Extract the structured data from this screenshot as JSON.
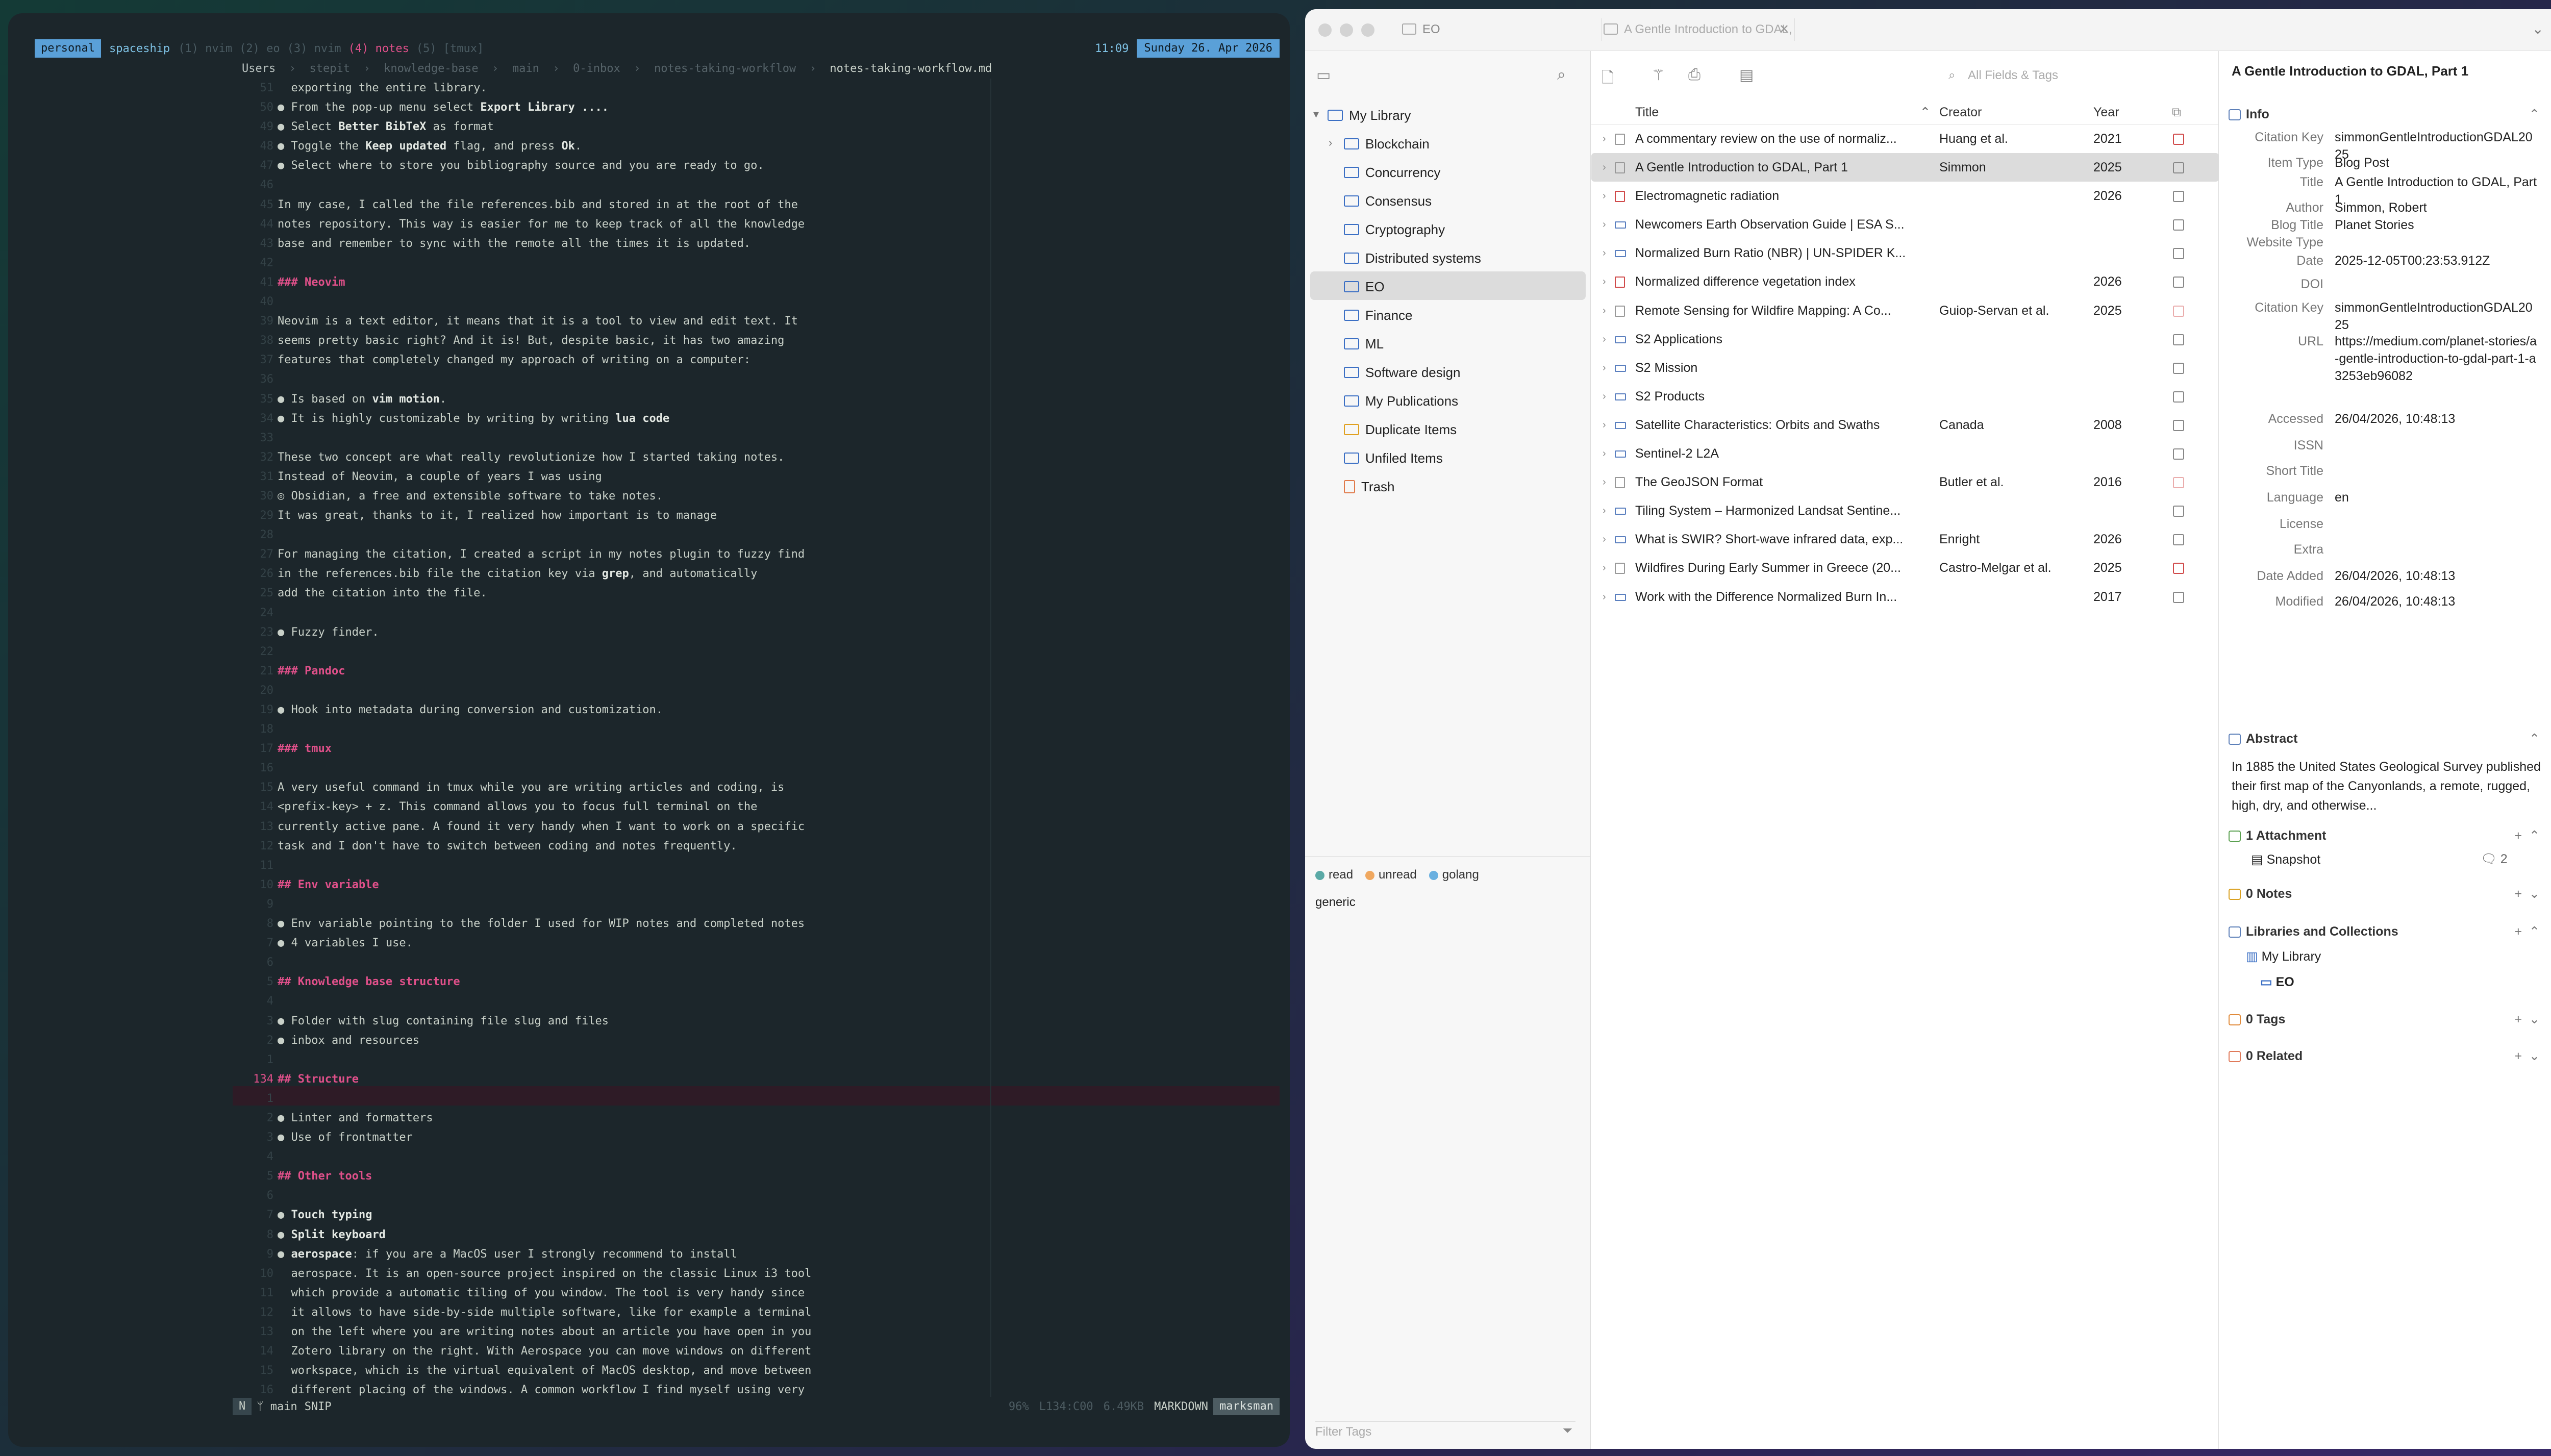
{
  "terminal": {
    "tmux": {
      "session": "personal",
      "host": "spaceship",
      "windows": [
        {
          "label": "(1) nvim",
          "current": false
        },
        {
          "label": "(2) eo",
          "current": false
        },
        {
          "label": "(3) nvim",
          "current": false
        },
        {
          "label": "(4) notes",
          "current": true
        },
        {
          "label": "(5) [tmux]",
          "current": false
        }
      ],
      "time": "11:09",
      "date": "Sunday 26. Apr 2026"
    },
    "breadcrumb": [
      "Users",
      "stepit",
      "knowledge-base",
      "main",
      "0-inbox",
      "notes-taking-workflow",
      "notes-taking-workflow.md"
    ],
    "gutter": [
      "52",
      "",
      "",
      "",
      "",
      "",
      "6",
      "",
      "",
      "",
      "",
      "",
      "",
      "",
      "",
      "",
      "",
      "",
      "",
      "",
      "",
      "",
      "",
      "",
      "",
      "",
      "",
      "",
      "",
      "",
      "",
      "",
      "",
      "",
      "",
      "",
      "",
      "",
      "",
      "",
      "",
      "",
      "",
      "",
      "",
      "",
      "",
      "",
      "",
      "",
      "",
      "",
      "",
      "",
      "",
      "",
      "",
      "",
      "",
      "",
      "",
      "",
      "",
      "",
      "",
      "",
      "",
      "",
      "",
      "",
      "",
      "",
      "",
      "",
      "",
      "",
      "",
      "",
      "",
      "",
      "",
      ""
    ],
    "lines": [
      "  exporting the entire library.",
      "● From the pop-up menu select **Export Library ....**",
      "● Select **Better BibTeX** as format",
      "● Toggle the **Keep updated** flag, and press **Ok**.",
      "● Select where to store you bibliography source and you are ready to go.",
      "",
      "In my case, I called the file references.bib and stored in at the root of the",
      "notes repository. This way is easier for me to keep track of all the knowledge",
      "base and remember to sync with the remote all the times it is updated.",
      "",
      "### Neovim",
      "",
      "Neovim is a text editor, it means that it is a tool to view and edit text. It",
      "seems pretty basic right? And it is! But, despite basic, it has two amazing",
      "features that completely changed my approach of writing on a computer:",
      "",
      "● Is based on **vim motion**.",
      "● It is highly customizable by writing by writing **lua code**",
      "",
      "These two concept are what really revolutionize how I started taking notes.",
      "Instead of Neovim, a couple of years I was using",
      "◎ Obsidian, a free and extensible software to take notes.",
      "It was great, thanks to it, I realized how important is to manage",
      "",
      "For managing the citation, I created a script in my notes plugin to fuzzy find",
      "in the references.bib file the citation key via **grep**, and automatically",
      "add the citation into the file.",
      "",
      "● Fuzzy finder.",
      "",
      "### Pandoc",
      "",
      "● Hook into metadata during conversion and customization.",
      "",
      "### tmux",
      "",
      "A very useful command in tmux while you are writing articles and coding, is",
      "<prefix-key> + z. This command allows you to focus full terminal on the",
      "currently active pane. A found it very handy when I want to work on a specific",
      "task and I don't have to switch between coding and notes frequently.",
      "",
      "## Env variable",
      "",
      "● Env variable pointing to the folder I used for WIP notes and completed notes",
      "● 4 variables I use.",
      "",
      "## Knowledge base structure",
      "",
      "● Folder with slug containing file slug and files",
      "● inbox and resources",
      "",
      "## Structure",
      "",
      "● Linter and formatters",
      "● Use of frontmatter",
      "",
      "## Other tools",
      "",
      "● **Touch typing**",
      "● **Split keyboard**",
      "● **aerospace**: if you are a MacOS user I strongly recommend to install",
      "  aerospace. It is an open-source project inspired on the classic Linux i3 tool",
      "  which provide a automatic tiling of you window. The tool is very handy since",
      "  it allows to have side-by-side multiple software, like for example a terminal",
      "  on the left where you are writing notes about an article you have open in you",
      "  Zotero library on the right. With Aerospace you can move windows on different",
      "  workspace, which is the virtual equivalent of MacOS desktop, and move between",
      "  different placing of the windows. A common workflow I find myself using very"
    ],
    "cursor_line_number": "134",
    "status": {
      "mode": "N",
      "branch": "ᛘ main",
      "snip": "SNIP",
      "percent": "96%",
      "position": "L134:C00",
      "size": "6.49KB",
      "filetype": "MARKDOWN",
      "lsp": "marksman"
    }
  },
  "zotero": {
    "tab_collection": "EO",
    "tab_item": "A Gentle Introduction to GDAL, Part 1",
    "collections": [
      {
        "label": "My Library",
        "level": 0,
        "twisty": "▾",
        "kind": "library"
      },
      {
        "label": "Blockchain",
        "level": 1,
        "twisty": "›",
        "kind": "folder"
      },
      {
        "label": "Concurrency",
        "level": 1,
        "twisty": "",
        "kind": "folder"
      },
      {
        "label": "Consensus",
        "level": 1,
        "twisty": "",
        "kind": "folder"
      },
      {
        "label": "Cryptography",
        "level": 1,
        "twisty": "",
        "kind": "folder"
      },
      {
        "label": "Distributed systems",
        "level": 1,
        "twisty": "",
        "kind": "folder"
      },
      {
        "label": "EO",
        "level": 1,
        "twisty": "",
        "kind": "folder",
        "selected": true
      },
      {
        "label": "Finance",
        "level": 1,
        "twisty": "",
        "kind": "folder"
      },
      {
        "label": "ML",
        "level": 1,
        "twisty": "",
        "kind": "folder"
      },
      {
        "label": "Software design",
        "level": 1,
        "twisty": "",
        "kind": "folder"
      },
      {
        "label": "My Publications",
        "level": 1,
        "twisty": "",
        "kind": "folder"
      },
      {
        "label": "Duplicate Items",
        "level": 1,
        "twisty": "",
        "kind": "warn"
      },
      {
        "label": "Unfiled Items",
        "level": 1,
        "twisty": "",
        "kind": "folder"
      },
      {
        "label": "Trash",
        "level": 1,
        "twisty": "",
        "kind": "trash"
      }
    ],
    "tags": [
      {
        "label": "read",
        "color": "#5aa9a6"
      },
      {
        "label": "unread",
        "color": "#f0a860"
      },
      {
        "label": "golang",
        "color": "#6ab0e0"
      }
    ],
    "generic_tag": "generic",
    "filter_tags_placeholder": "Filter Tags",
    "search_placeholder": "All Fields & Tags",
    "columns": {
      "title": "Title",
      "sort": "⌃",
      "creator": "Creator",
      "year": "Year",
      "attach": "⧉"
    },
    "items": [
      {
        "title": "A commentary review on the use of normaliz...",
        "creator": "Huang et al.",
        "year": "2021",
        "type": "doc",
        "attach": "pdf"
      },
      {
        "title": "A Gentle Introduction to GDAL, Part 1",
        "creator": "Simmon",
        "year": "2025",
        "type": "doc",
        "attach": "snap",
        "selected": true
      },
      {
        "title": "Electromagnetic radiation",
        "creator": "",
        "year": "2026",
        "type": "book",
        "attach": "snap"
      },
      {
        "title": "Newcomers Earth Observation Guide | ESA S...",
        "creator": "",
        "year": "",
        "type": "blog",
        "attach": "snap"
      },
      {
        "title": "Normalized Burn Ratio (NBR) | UN-SPIDER K...",
        "creator": "",
        "year": "",
        "type": "blog",
        "attach": "snap"
      },
      {
        "title": "Normalized difference vegetation index",
        "creator": "",
        "year": "2026",
        "type": "book",
        "attach": "snap"
      },
      {
        "title": "Remote Sensing for Wildfire Mapping: A Co...",
        "creator": "Guiop-Servan et al.",
        "year": "2025",
        "type": "doc",
        "attach": "pdf-light"
      },
      {
        "title": "S2 Applications",
        "creator": "",
        "year": "",
        "type": "blog",
        "attach": "snap"
      },
      {
        "title": "S2 Mission",
        "creator": "",
        "year": "",
        "type": "blog",
        "attach": "snap"
      },
      {
        "title": "S2 Products",
        "creator": "",
        "year": "",
        "type": "blog",
        "attach": "snap"
      },
      {
        "title": "Satellite Characteristics: Orbits and Swaths",
        "creator": "Canada",
        "year": "2008",
        "type": "blog",
        "attach": "snap"
      },
      {
        "title": "Sentinel-2 L2A",
        "creator": "",
        "year": "",
        "type": "blog",
        "attach": "snap"
      },
      {
        "title": "The GeoJSON Format",
        "creator": "Butler et al.",
        "year": "2016",
        "type": "doc",
        "attach": "pdf-light"
      },
      {
        "title": "Tiling System – Harmonized Landsat Sentine...",
        "creator": "",
        "year": "",
        "type": "blog",
        "attach": "snap"
      },
      {
        "title": "What is SWIR? Short-wave infrared data, exp...",
        "creator": "Enright",
        "year": "2026",
        "type": "blog",
        "attach": "snap"
      },
      {
        "title": "Wildfires During Early Summer in Greece (20...",
        "creator": "Castro-Melgar et al.",
        "year": "2025",
        "type": "doc",
        "attach": "pdf"
      },
      {
        "title": "Work with the Difference Normalized Burn In...",
        "creator": "",
        "year": "2017",
        "type": "blog",
        "attach": "snap"
      }
    ],
    "info": {
      "header_title": "A Gentle Introduction to GDAL, Part 1",
      "section": "Info",
      "fields": [
        {
          "label": "Citation Key",
          "value": "simmonGentleIntroductionGDAL2025"
        },
        {
          "label": "Item Type",
          "value": "Blog Post"
        },
        {
          "label": "Title",
          "value": "A Gentle Introduction to GDAL, Part 1"
        },
        {
          "label": "Author",
          "value": "Simmon, Robert"
        },
        {
          "label": "Blog Title",
          "value": "Planet Stories"
        },
        {
          "label": "Website Type",
          "value": ""
        },
        {
          "label": "Date",
          "value": "2025-12-05T00:23:53.912Z"
        },
        {
          "label": "DOI",
          "value": ""
        },
        {
          "label": "Citation Key",
          "value": "simmonGentleIntroductionGDAL2025"
        },
        {
          "label": "URL",
          "value": "https://medium.com/planet-stories/a-gentle-introduction-to-gdal-part-1-a3253eb96082"
        },
        {
          "label": "Accessed",
          "value": "26/04/2026, 10:48:13"
        },
        {
          "label": "ISSN",
          "value": ""
        },
        {
          "label": "Short Title",
          "value": ""
        },
        {
          "label": "Language",
          "value": "en"
        },
        {
          "label": "License",
          "value": ""
        },
        {
          "label": "Extra",
          "value": ""
        },
        {
          "label": "Date Added",
          "value": "26/04/2026, 10:48:13"
        },
        {
          "label": "Modified",
          "value": "26/04/2026, 10:48:13"
        }
      ],
      "abstract_title": "Abstract",
      "abstract": "In 1885 the United States Geological Survey published their first map of the Canyonlands, a remote, rugged, high, dry, and otherwise...",
      "attachments_title": "1 Attachment",
      "attachment_name": "Snapshot",
      "attachment_count": "2",
      "notes_title": "0 Notes",
      "libraries_title": "Libraries and Collections",
      "library": "My Library",
      "collection": "EO",
      "tags_title": "0 Tags",
      "related_title": "0 Related"
    }
  }
}
